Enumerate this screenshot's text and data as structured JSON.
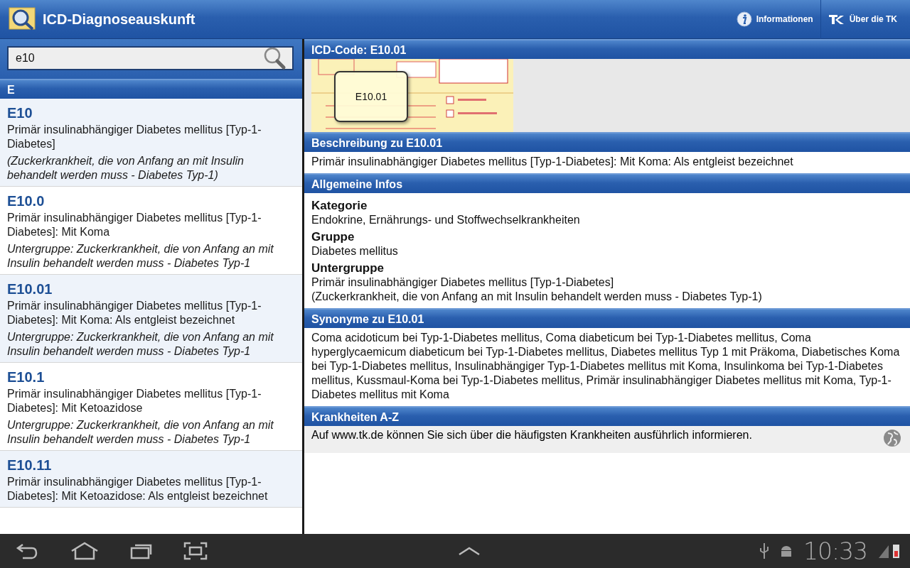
{
  "app_bar": {
    "title": "ICD-Diagnoseauskunft",
    "actions": [
      {
        "kind": "info",
        "label": "Informationen"
      },
      {
        "kind": "tk",
        "label": "Über die TK"
      }
    ]
  },
  "search": {
    "value": "e10"
  },
  "list": {
    "section": "E",
    "items": [
      {
        "code": "E10",
        "description": "Primär insulinabhängiger Diabetes mellitus [Typ-1-Diabetes]",
        "note": "(Zuckerkrankheit, die von Anfang an mit Insulin behandelt werden muss - Diabetes Typ-1)"
      },
      {
        "code": "E10.0",
        "description": "Primär insulinabhängiger Diabetes mellitus [Typ-1-Diabetes]: Mit Koma",
        "note": "Untergruppe: Zuckerkrankheit, die von Anfang an mit Insulin behandelt werden muss - Diabetes Typ-1"
      },
      {
        "code": "E10.01",
        "description": "Primär insulinabhängiger Diabetes mellitus [Typ-1-Diabetes]: Mit Koma: Als entgleist bezeichnet",
        "note": "Untergruppe: Zuckerkrankheit, die von Anfang an mit Insulin behandelt werden muss - Diabetes Typ-1"
      },
      {
        "code": "E10.1",
        "description": "Primär insulinabhängiger Diabetes mellitus [Typ-1-Diabetes]: Mit Ketoazidose",
        "note": "Untergruppe: Zuckerkrankheit, die von Anfang an mit Insulin behandelt werden muss - Diabetes Typ-1"
      },
      {
        "code": "E10.11",
        "description": "Primär insulinabhängiger Diabetes mellitus [Typ-1-Diabetes]: Mit Ketoazidose: Als entgleist bezeichnet"
      }
    ]
  },
  "detail": {
    "header": "ICD-Code: E10.01",
    "image": {
      "kind": "picture",
      "label": "E10.01"
    },
    "sections": [
      {
        "kind": "text",
        "title": "Beschreibung zu E10.01",
        "text": "Primär insulinabhängiger Diabetes mellitus [Typ-1-Diabetes]: Mit Koma: Als entgleist bezeichnet"
      },
      {
        "kind": "fields",
        "title": "Allgemeine Infos",
        "fields": [
          {
            "label": "Kategorie",
            "lines": [
              "Endokrine, Ernährungs- und Stoffwechselkrankheiten"
            ]
          },
          {
            "label": "Gruppe",
            "lines": [
              "Diabetes mellitus"
            ]
          },
          {
            "label": "Untergruppe",
            "lines": [
              "Primär insulinabhängiger Diabetes mellitus [Typ-1-Diabetes]",
              "(Zuckerkrankheit, die von Anfang an mit Insulin behandelt werden muss - Diabetes Typ-1)"
            ]
          }
        ]
      },
      {
        "kind": "text",
        "title": "Synonyme zu E10.01",
        "text": "Coma acidoticum bei Typ-1-Diabetes mellitus, Coma diabeticum bei Typ-1-Diabetes mellitus, Coma hyperglycaemicum diabeticum bei Typ-1-Diabetes mellitus, Diabetes mellitus Typ 1 mit Präkoma, Diabetisches Koma bei Typ-1-Diabetes mellitus, Insulinabhängiger Typ-1-Diabetes mellitus mit Koma, Insulinkoma bei Typ-1-Diabetes mellitus, Kussmaul-Koma bei Typ-1-Diabetes mellitus, Primär insulinabhängiger Diabetes mellitus mit Koma, Typ-1-Diabetes mellitus mit Koma"
      },
      {
        "kind": "link",
        "title": "Krankheiten A-Z",
        "text": "Auf www.tk.de können Sie sich über die häufigsten Krankheiten ausführlich informieren."
      }
    ]
  },
  "system_bar": {
    "clock": "10:33"
  }
}
